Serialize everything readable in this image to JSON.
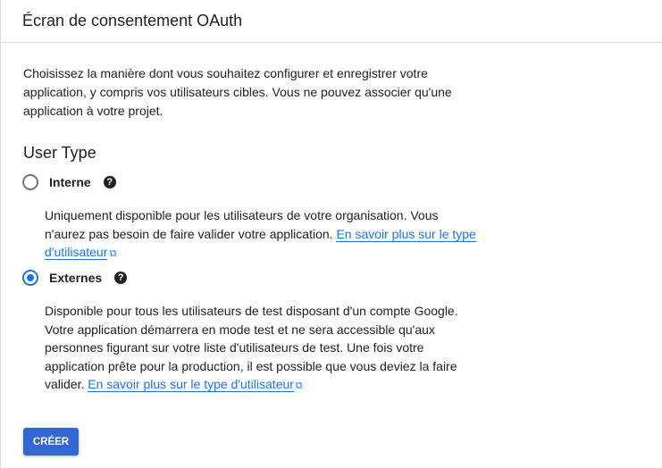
{
  "header": {
    "title": "Écran de consentement OAuth"
  },
  "intro": "Choisissez la manière dont vous souhaitez configurer et enregistrer votre application, y compris vos utilisateurs cibles. Vous ne pouvez associer qu'une application à votre projet.",
  "user_type": {
    "heading": "User Type",
    "options": [
      {
        "label": "Interne",
        "selected": false,
        "help_icon": "help-circle-icon",
        "description": "Uniquement disponible pour les utilisateurs de votre organisation. Vous n'aurez pas besoin de faire valider votre application.",
        "link": "En savoir plus sur le type d'utilisateur"
      },
      {
        "label": "Externes",
        "selected": true,
        "help_icon": "help-circle-icon",
        "description": "Disponible pour tous les utilisateurs de test disposant d'un compte Google. Votre application démarrera en mode test et ne sera accessible qu'aux personnes figurant sur votre liste d'utilisateurs de test. Une fois votre application prête pour la production, il est possible que vous deviez la faire valider.",
        "link": "En savoir plus sur le type d'utilisateur"
      }
    ]
  },
  "create_button": "CRÉER",
  "colors": {
    "accent": "#1a73e8",
    "button": "#3367d6"
  }
}
